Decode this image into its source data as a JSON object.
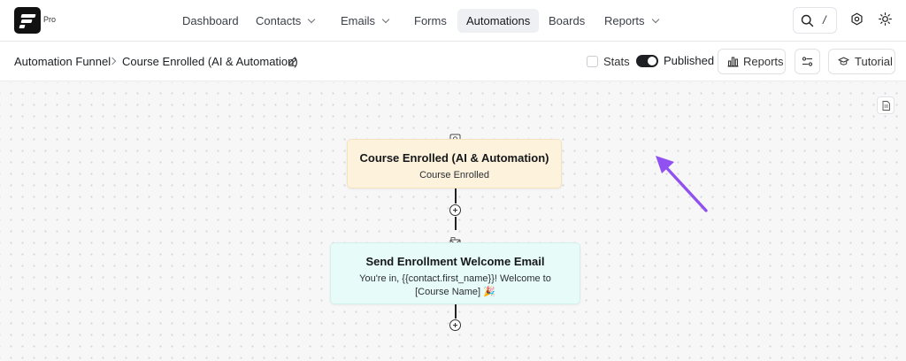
{
  "app": {
    "badge": "Pro"
  },
  "nav": {
    "items": [
      {
        "label": "Dashboard"
      },
      {
        "label": "Contacts"
      },
      {
        "label": "Emails"
      },
      {
        "label": "Forms"
      },
      {
        "label": "Automations"
      },
      {
        "label": "Boards"
      },
      {
        "label": "Reports"
      }
    ],
    "search_shortcut": "/"
  },
  "breadcrumb": {
    "parent": "Automation Funnel",
    "current": "Course Enrolled (AI & Automation)"
  },
  "header": {
    "stats_label": "Stats",
    "published_label": "Published",
    "reports_label": "Reports",
    "tutorial_label": "Tutorial"
  },
  "nodes": {
    "trigger": {
      "title": "Course Enrolled (AI & Automation)",
      "subtitle": "Course Enrolled"
    },
    "email": {
      "title": "Send Enrollment Welcome Email",
      "line1": "You're in, {{contact.first_name}}! Welcome to",
      "line2": "[Course Name] 🎉"
    }
  },
  "colors": {
    "accent_arrow": "#9151f0",
    "trigger_bg": "#fdf2dc",
    "email_bg": "#e7fbf8",
    "active_nav_bg": "#eef0f3"
  },
  "icons": {
    "logo": "fluentcrm-logo",
    "search": "search-icon",
    "settings": "gear-icon",
    "theme": "sun-icon",
    "edit": "pencil-icon",
    "reports": "bar-chart-icon",
    "filters": "sliders-icon",
    "tutorial": "graduation-cap-icon",
    "document": "document-icon"
  }
}
